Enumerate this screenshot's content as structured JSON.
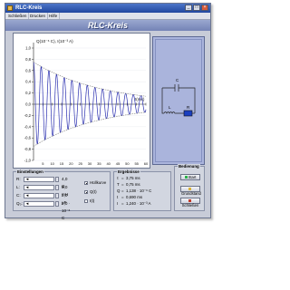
{
  "window": {
    "title": "RLC-Kreis",
    "min": "_",
    "max": "□",
    "close": "×"
  },
  "menu": [
    "Schließen",
    "Drucken",
    "Hilfe"
  ],
  "header": "RLC-Kreis",
  "chart_data": {
    "type": "line",
    "ylabel": "Q(10⁻⁶ C), I(10⁻³ A)",
    "xlabel": "t(ms)",
    "yticks": [
      "1,0",
      "0,8",
      "0,6",
      "0,4",
      "0,2",
      "0,0",
      "-0,2",
      "-0,4",
      "-0,6",
      "-0,8",
      "-1,0"
    ],
    "xticks": [
      "5",
      "10",
      "15",
      "20",
      "25",
      "30",
      "35",
      "40",
      "45",
      "50",
      "55",
      "60"
    ],
    "ylim": [
      -1.0,
      1.0
    ],
    "xlim": [
      0,
      60
    ],
    "series": [
      {
        "kind": "oscillation",
        "color": "#2a2fb0",
        "amplitude": 0.75,
        "period_ms": 4.1,
        "decay_ms": 36.0
      },
      {
        "kind": "envelope",
        "color": "#7a7a7a",
        "amplitude": 0.75,
        "decay_ms": 36.0
      }
    ]
  },
  "circuit": {
    "c_label": "C",
    "l_label": "L",
    "r_label": "R"
  },
  "settings": {
    "legend": "Einstellungen",
    "rows": [
      {
        "label": "R:",
        "value": "4,0 Ω"
      },
      {
        "label": "L:",
        "value": "8,0 mH"
      },
      {
        "label": "C:",
        "value": "2,0 μF"
      },
      {
        "label": "Q₀:",
        "value": "2,0 · 10⁻⁶ C"
      }
    ],
    "options": [
      {
        "label": "Hüllkurve",
        "checked": true
      },
      {
        "label": "Q(t)",
        "checked": true
      },
      {
        "label": "I(t)",
        "checked": false
      }
    ]
  },
  "results": {
    "legend": "Ergebnisse",
    "rows": [
      {
        "label": "τ",
        "value": "3,75 ms"
      },
      {
        "label": "T",
        "value": "0,75 ms"
      },
      {
        "label": "Q",
        "value": "1,138 · 10⁻⁶ C"
      },
      {
        "label": "t",
        "value": "0,690 ms"
      },
      {
        "label": "I",
        "value": "1,240 · 10⁻³ A"
      }
    ]
  },
  "controls": {
    "legend": "Bedienung",
    "start": "Start",
    "reset": "Grundstand",
    "close": "Schließen",
    "colors": {
      "start": "#2bb04a",
      "reset": "#d9b23a",
      "close": "#c23a2a"
    }
  }
}
